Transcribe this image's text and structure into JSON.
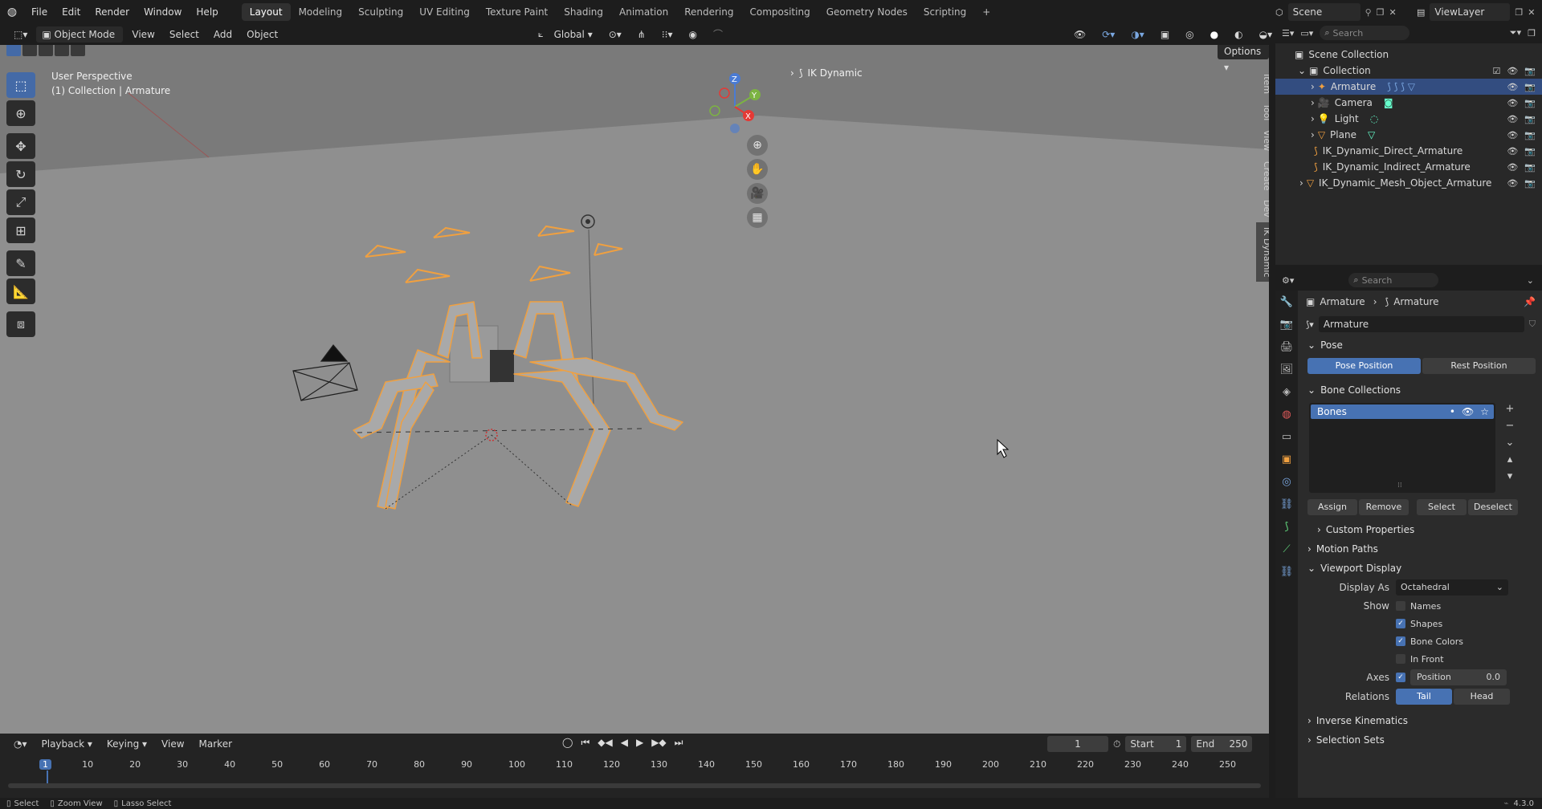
{
  "menubar": {
    "items": [
      "File",
      "Edit",
      "Render",
      "Window",
      "Help"
    ],
    "workspaces": [
      "Layout",
      "Modeling",
      "Sculpting",
      "UV Editing",
      "Texture Paint",
      "Shading",
      "Animation",
      "Rendering",
      "Compositing",
      "Geometry Nodes",
      "Scripting"
    ],
    "active_workspace": "Layout",
    "add_tab": "+",
    "scene_label": "Scene",
    "viewlayer_label": "ViewLayer"
  },
  "viewport_header": {
    "mode": "Object Mode",
    "menus": [
      "View",
      "Select",
      "Add",
      "Object"
    ],
    "transform_orientation": "Global",
    "options": "Options"
  },
  "viewport": {
    "perspective": "User Perspective",
    "context": "(1) Collection | Armature",
    "ik_panel": "IK Dynamic",
    "side_tabs": [
      "Item",
      "Tool",
      "View",
      "Create",
      "Dev",
      "IK Dynamic"
    ],
    "gizmo_axes": [
      "Z",
      "Y",
      "X"
    ]
  },
  "outliner": {
    "search_placeholder": "Search",
    "root": "Scene Collection",
    "collection": "Collection",
    "items": [
      {
        "label": "Armature",
        "selected": true
      },
      {
        "label": "Camera",
        "selected": false
      },
      {
        "label": "Light",
        "selected": false
      },
      {
        "label": "Plane",
        "selected": false
      }
    ],
    "extra_items": [
      "IK_Dynamic_Direct_Armature",
      "IK_Dynamic_Indirect_Armature",
      "IK_Dynamic_Mesh_Object_Armature"
    ]
  },
  "properties": {
    "search_placeholder": "Search",
    "breadcrumb_object": "Armature",
    "breadcrumb_data": "Armature",
    "data_name": "Armature",
    "pose": {
      "title": "Pose",
      "pose_position": "Pose Position",
      "rest_position": "Rest Position"
    },
    "bone_collections": {
      "title": "Bone Collections",
      "items": [
        "Bones"
      ],
      "assign": "Assign",
      "remove": "Remove",
      "select": "Select",
      "deselect": "Deselect"
    },
    "custom_properties": "Custom Properties",
    "motion_paths": "Motion Paths",
    "viewport_display": {
      "title": "Viewport Display",
      "display_as_label": "Display As",
      "display_as_value": "Octahedral",
      "show_label": "Show",
      "show_options": [
        {
          "label": "Names",
          "checked": false
        },
        {
          "label": "Shapes",
          "checked": true
        },
        {
          "label": "Bone Colors",
          "checked": true
        },
        {
          "label": "In Front",
          "checked": false
        }
      ],
      "axes_label": "Axes",
      "axes_position_label": "Position",
      "axes_position_value": "0.0",
      "relations_label": "Relations",
      "relations_tail": "Tail",
      "relations_head": "Head"
    },
    "inverse_kinematics": "Inverse Kinematics",
    "selection_sets": "Selection Sets"
  },
  "timeline": {
    "menus": [
      "Playback",
      "Keying",
      "View",
      "Marker"
    ],
    "current_frame": "1",
    "start_label": "Start",
    "start_value": "1",
    "end_label": "End",
    "end_value": "250",
    "ticks": [
      "1",
      "10",
      "20",
      "30",
      "40",
      "50",
      "60",
      "70",
      "80",
      "90",
      "100",
      "110",
      "120",
      "130",
      "140",
      "150",
      "160",
      "170",
      "180",
      "190",
      "200",
      "210",
      "220",
      "230",
      "240",
      "250"
    ]
  },
  "statusbar": {
    "items": [
      "Select",
      "Zoom View",
      "Lasso Select"
    ],
    "version": "4.3.0"
  },
  "colors": {
    "accent": "#4772b3",
    "bone": "#f0a040",
    "viewport_bg": "#8c8c8c"
  }
}
